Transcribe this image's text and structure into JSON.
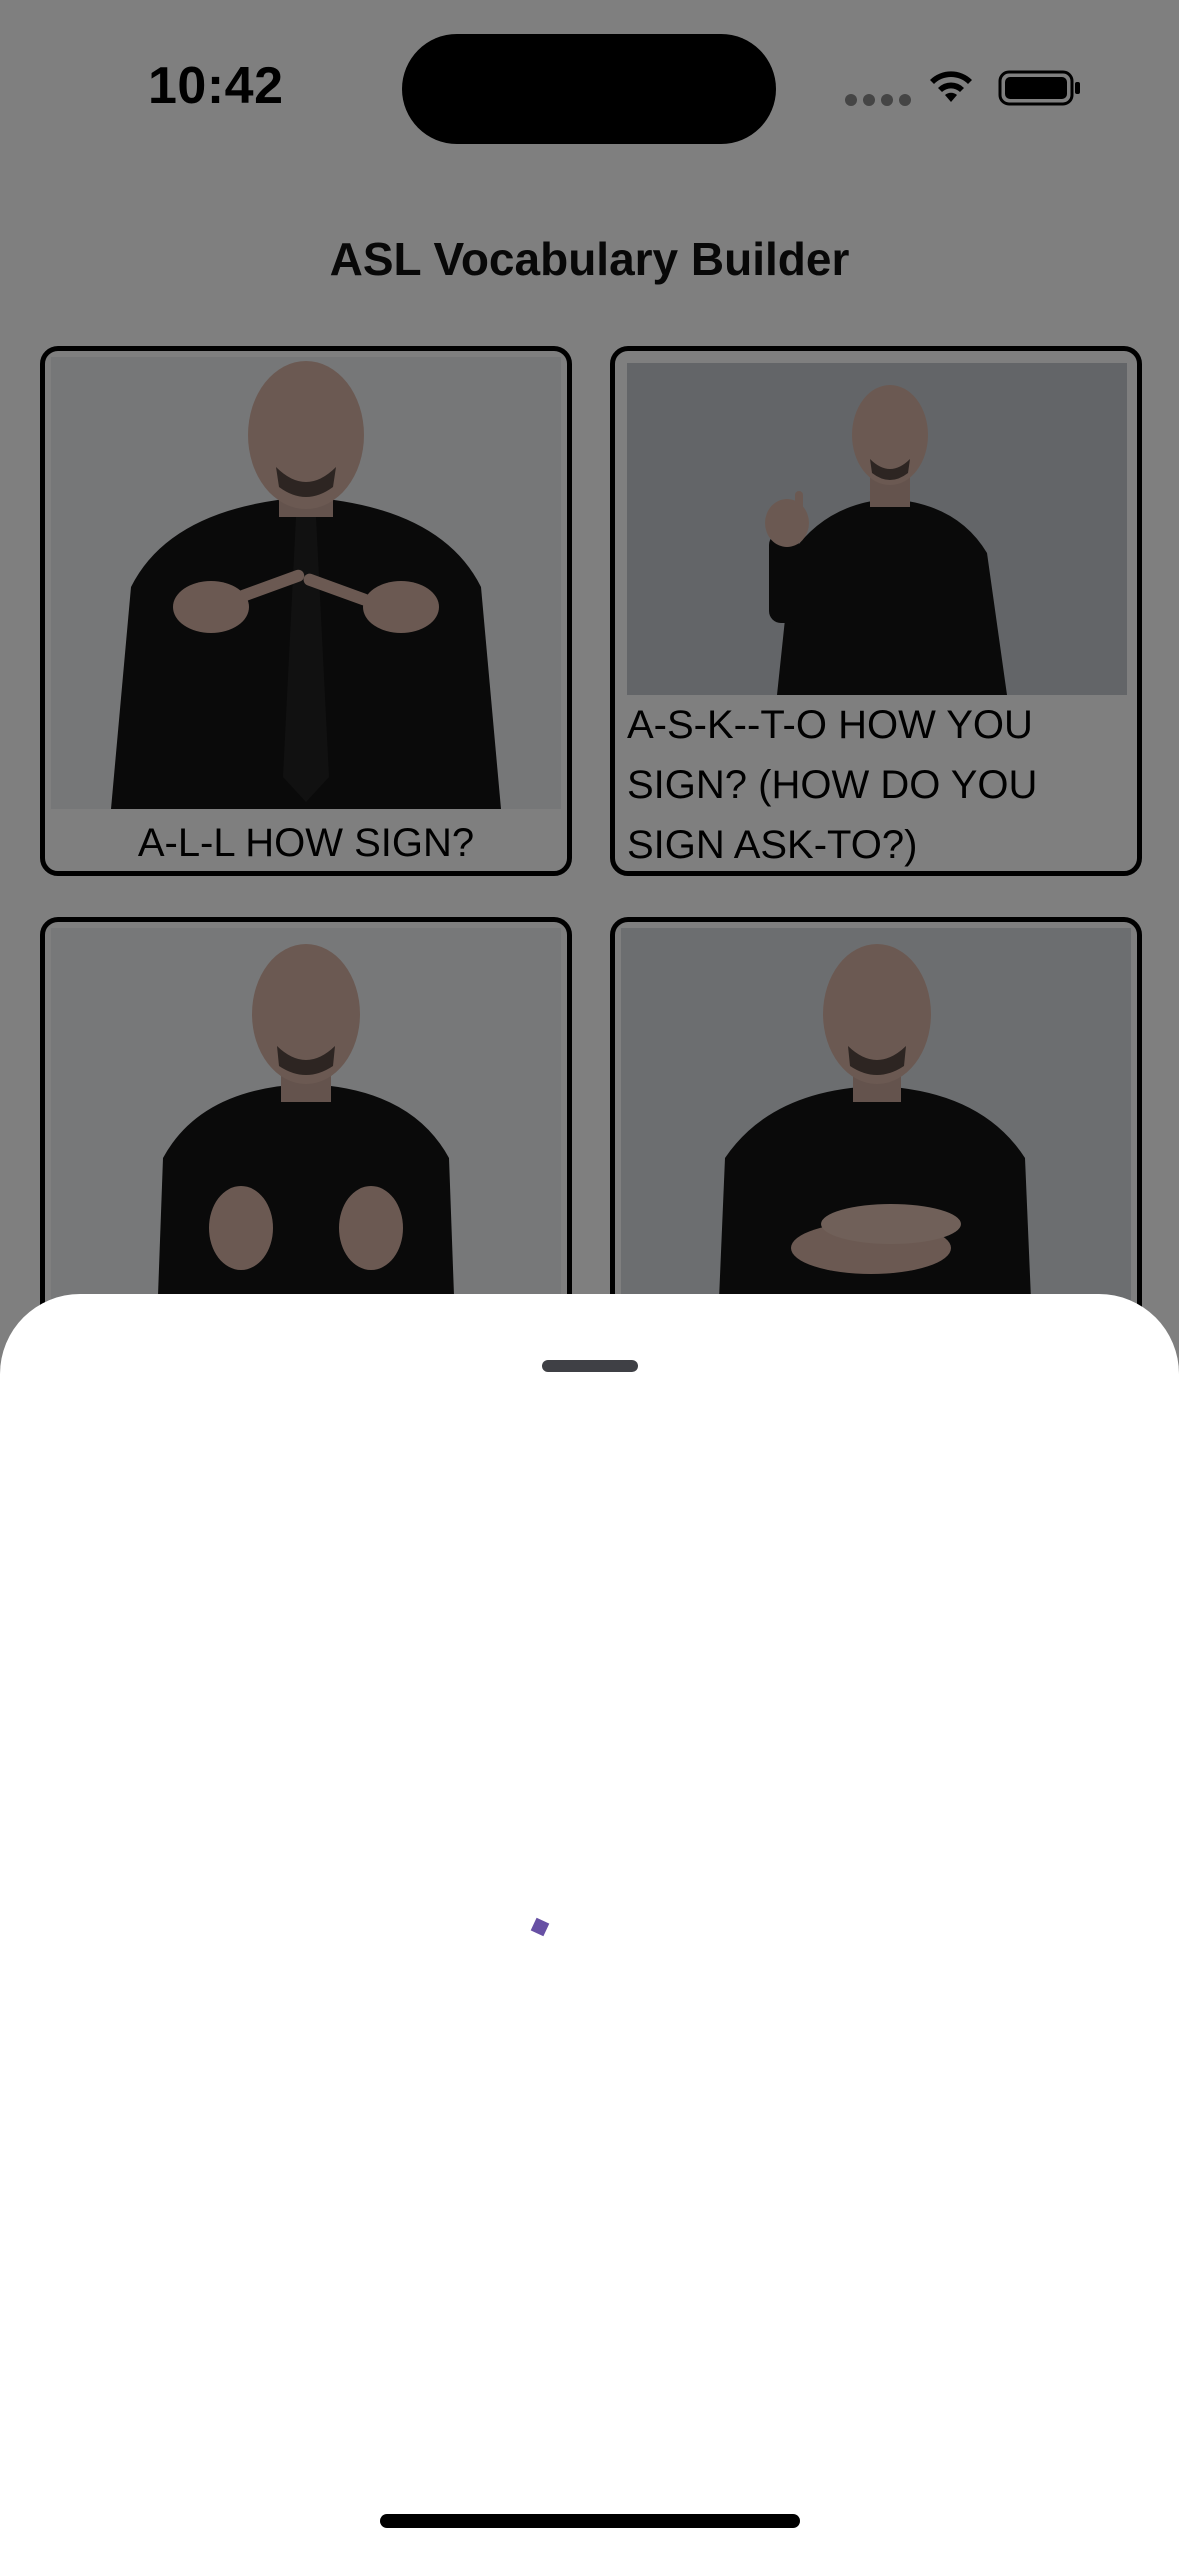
{
  "status_bar": {
    "time": "10:42",
    "icons": [
      "cellular-signal-icon",
      "wifi-icon",
      "battery-icon"
    ]
  },
  "header": {
    "title": "ASL Vocabulary Builder"
  },
  "cards": [
    {
      "label": "A-L-L HOW SIGN?",
      "image": "signer-pointing-index-fingers"
    },
    {
      "label": "A-S-K--T-O HOW YOU SIGN? (HOW DO YOU SIGN ASK-TO?)",
      "image": "signer-raised-index-finger"
    },
    {
      "label": "",
      "image": "signer-open-hands-palms-up"
    },
    {
      "label": "",
      "image": "signer-hands-stacked"
    }
  ],
  "sheet": {
    "state": "loading",
    "spinner_color": "#6750a4"
  },
  "colors": {
    "scrim": "rgba(0,0,0,0.5)",
    "card_border": "#000000",
    "sheet_background": "#ffffff"
  }
}
